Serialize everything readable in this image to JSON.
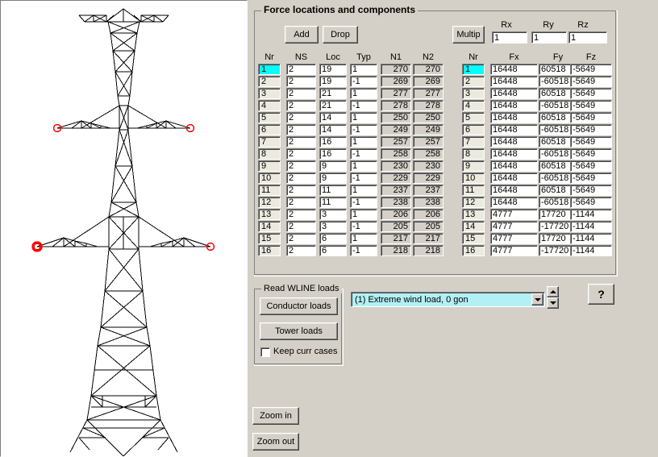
{
  "window": {
    "background_color": "#d4d0c8",
    "drawing_panel": {
      "name": "tower-elevation-view",
      "background_color": "#ffffff",
      "line_color": "#000000",
      "marker_color": "#ff0000",
      "marker_count": 6,
      "selected_marker_index": 4
    }
  },
  "force_group": {
    "title": "Force locations and components",
    "add_label": "Add",
    "drop_label": "Drop",
    "multip_label": "Multip",
    "multipliers": {
      "rx_label": "Rx",
      "ry_label": "Ry",
      "rz_label": "Rz",
      "rx_value": "1",
      "ry_value": "1",
      "rz_value": "1"
    },
    "loc_table": {
      "headers": [
        "Nr",
        "NS",
        "Loc",
        "Typ",
        "N1",
        "N2"
      ],
      "selected_row": 1,
      "rows": [
        {
          "nr": "1",
          "ns": "2",
          "loc": "19",
          "typ": "1",
          "n1": "270",
          "n2": "270"
        },
        {
          "nr": "2",
          "ns": "2",
          "loc": "19",
          "typ": "-1",
          "n1": "269",
          "n2": "269"
        },
        {
          "nr": "3",
          "ns": "2",
          "loc": "21",
          "typ": "1",
          "n1": "277",
          "n2": "277"
        },
        {
          "nr": "4",
          "ns": "2",
          "loc": "21",
          "typ": "-1",
          "n1": "278",
          "n2": "278"
        },
        {
          "nr": "5",
          "ns": "2",
          "loc": "14",
          "typ": "1",
          "n1": "250",
          "n2": "250"
        },
        {
          "nr": "6",
          "ns": "2",
          "loc": "14",
          "typ": "-1",
          "n1": "249",
          "n2": "249"
        },
        {
          "nr": "7",
          "ns": "2",
          "loc": "16",
          "typ": "1",
          "n1": "257",
          "n2": "257"
        },
        {
          "nr": "8",
          "ns": "2",
          "loc": "16",
          "typ": "-1",
          "n1": "258",
          "n2": "258"
        },
        {
          "nr": "9",
          "ns": "2",
          "loc": "9",
          "typ": "1",
          "n1": "230",
          "n2": "230"
        },
        {
          "nr": "10",
          "ns": "2",
          "loc": "9",
          "typ": "-1",
          "n1": "229",
          "n2": "229"
        },
        {
          "nr": "11",
          "ns": "2",
          "loc": "11",
          "typ": "1",
          "n1": "237",
          "n2": "237"
        },
        {
          "nr": "12",
          "ns": "2",
          "loc": "11",
          "typ": "-1",
          "n1": "238",
          "n2": "238"
        },
        {
          "nr": "13",
          "ns": "2",
          "loc": "3",
          "typ": "1",
          "n1": "206",
          "n2": "206"
        },
        {
          "nr": "14",
          "ns": "2",
          "loc": "3",
          "typ": "-1",
          "n1": "205",
          "n2": "205"
        },
        {
          "nr": "15",
          "ns": "2",
          "loc": "6",
          "typ": "1",
          "n1": "217",
          "n2": "217"
        },
        {
          "nr": "16",
          "ns": "2",
          "loc": "6",
          "typ": "-1",
          "n1": "218",
          "n2": "218"
        }
      ]
    },
    "force_table": {
      "headers": [
        "Nr",
        "Fx",
        "Fy",
        "Fz"
      ],
      "selected_row": 1,
      "rows": [
        {
          "nr": "1",
          "fx": "16448",
          "fy": "60518",
          "fz": "-5649"
        },
        {
          "nr": "2",
          "fx": "16448",
          "fy": "-60518",
          "fz": "-5649"
        },
        {
          "nr": "3",
          "fx": "16448",
          "fy": "60518",
          "fz": "-5649"
        },
        {
          "nr": "4",
          "fx": "16448",
          "fy": "-60518",
          "fz": "-5649"
        },
        {
          "nr": "5",
          "fx": "16448",
          "fy": "60518",
          "fz": "-5649"
        },
        {
          "nr": "6",
          "fx": "16448",
          "fy": "-60518",
          "fz": "-5649"
        },
        {
          "nr": "7",
          "fx": "16448",
          "fy": "60518",
          "fz": "-5649"
        },
        {
          "nr": "8",
          "fx": "16448",
          "fy": "-60518",
          "fz": "-5649"
        },
        {
          "nr": "9",
          "fx": "16448",
          "fy": "60518",
          "fz": "-5649"
        },
        {
          "nr": "10",
          "fx": "16448",
          "fy": "-60518",
          "fz": "-5649"
        },
        {
          "nr": "11",
          "fx": "16448",
          "fy": "60518",
          "fz": "-5649"
        },
        {
          "nr": "12",
          "fx": "16448",
          "fy": "-60518",
          "fz": "-5649"
        },
        {
          "nr": "13",
          "fx": "4777",
          "fy": "17720",
          "fz": "-1144"
        },
        {
          "nr": "14",
          "fx": "4777",
          "fy": "-17720",
          "fz": "-1144"
        },
        {
          "nr": "15",
          "fx": "4777",
          "fy": "17720",
          "fz": "-1144"
        },
        {
          "nr": "16",
          "fx": "4777",
          "fy": "-17720",
          "fz": "-1144"
        }
      ]
    }
  },
  "wline_group": {
    "title": "Read WLINE loads",
    "conductor_loads_label": "Conductor loads",
    "tower_loads_label": "Tower loads",
    "keep_curr_cases_label": "Keep curr cases",
    "keep_curr_cases_checked": false
  },
  "loadcase": {
    "selected": "(1)  Extreme wind load, 0 gon",
    "dropdown_icon": "chevron-down-icon",
    "spin_up_icon": "triangle-up-icon",
    "spin_down_icon": "triangle-down-icon"
  },
  "help": {
    "label": "?"
  },
  "zoom": {
    "zoom_in_label": "Zoom in",
    "zoom_out_label": "Zoom out"
  }
}
